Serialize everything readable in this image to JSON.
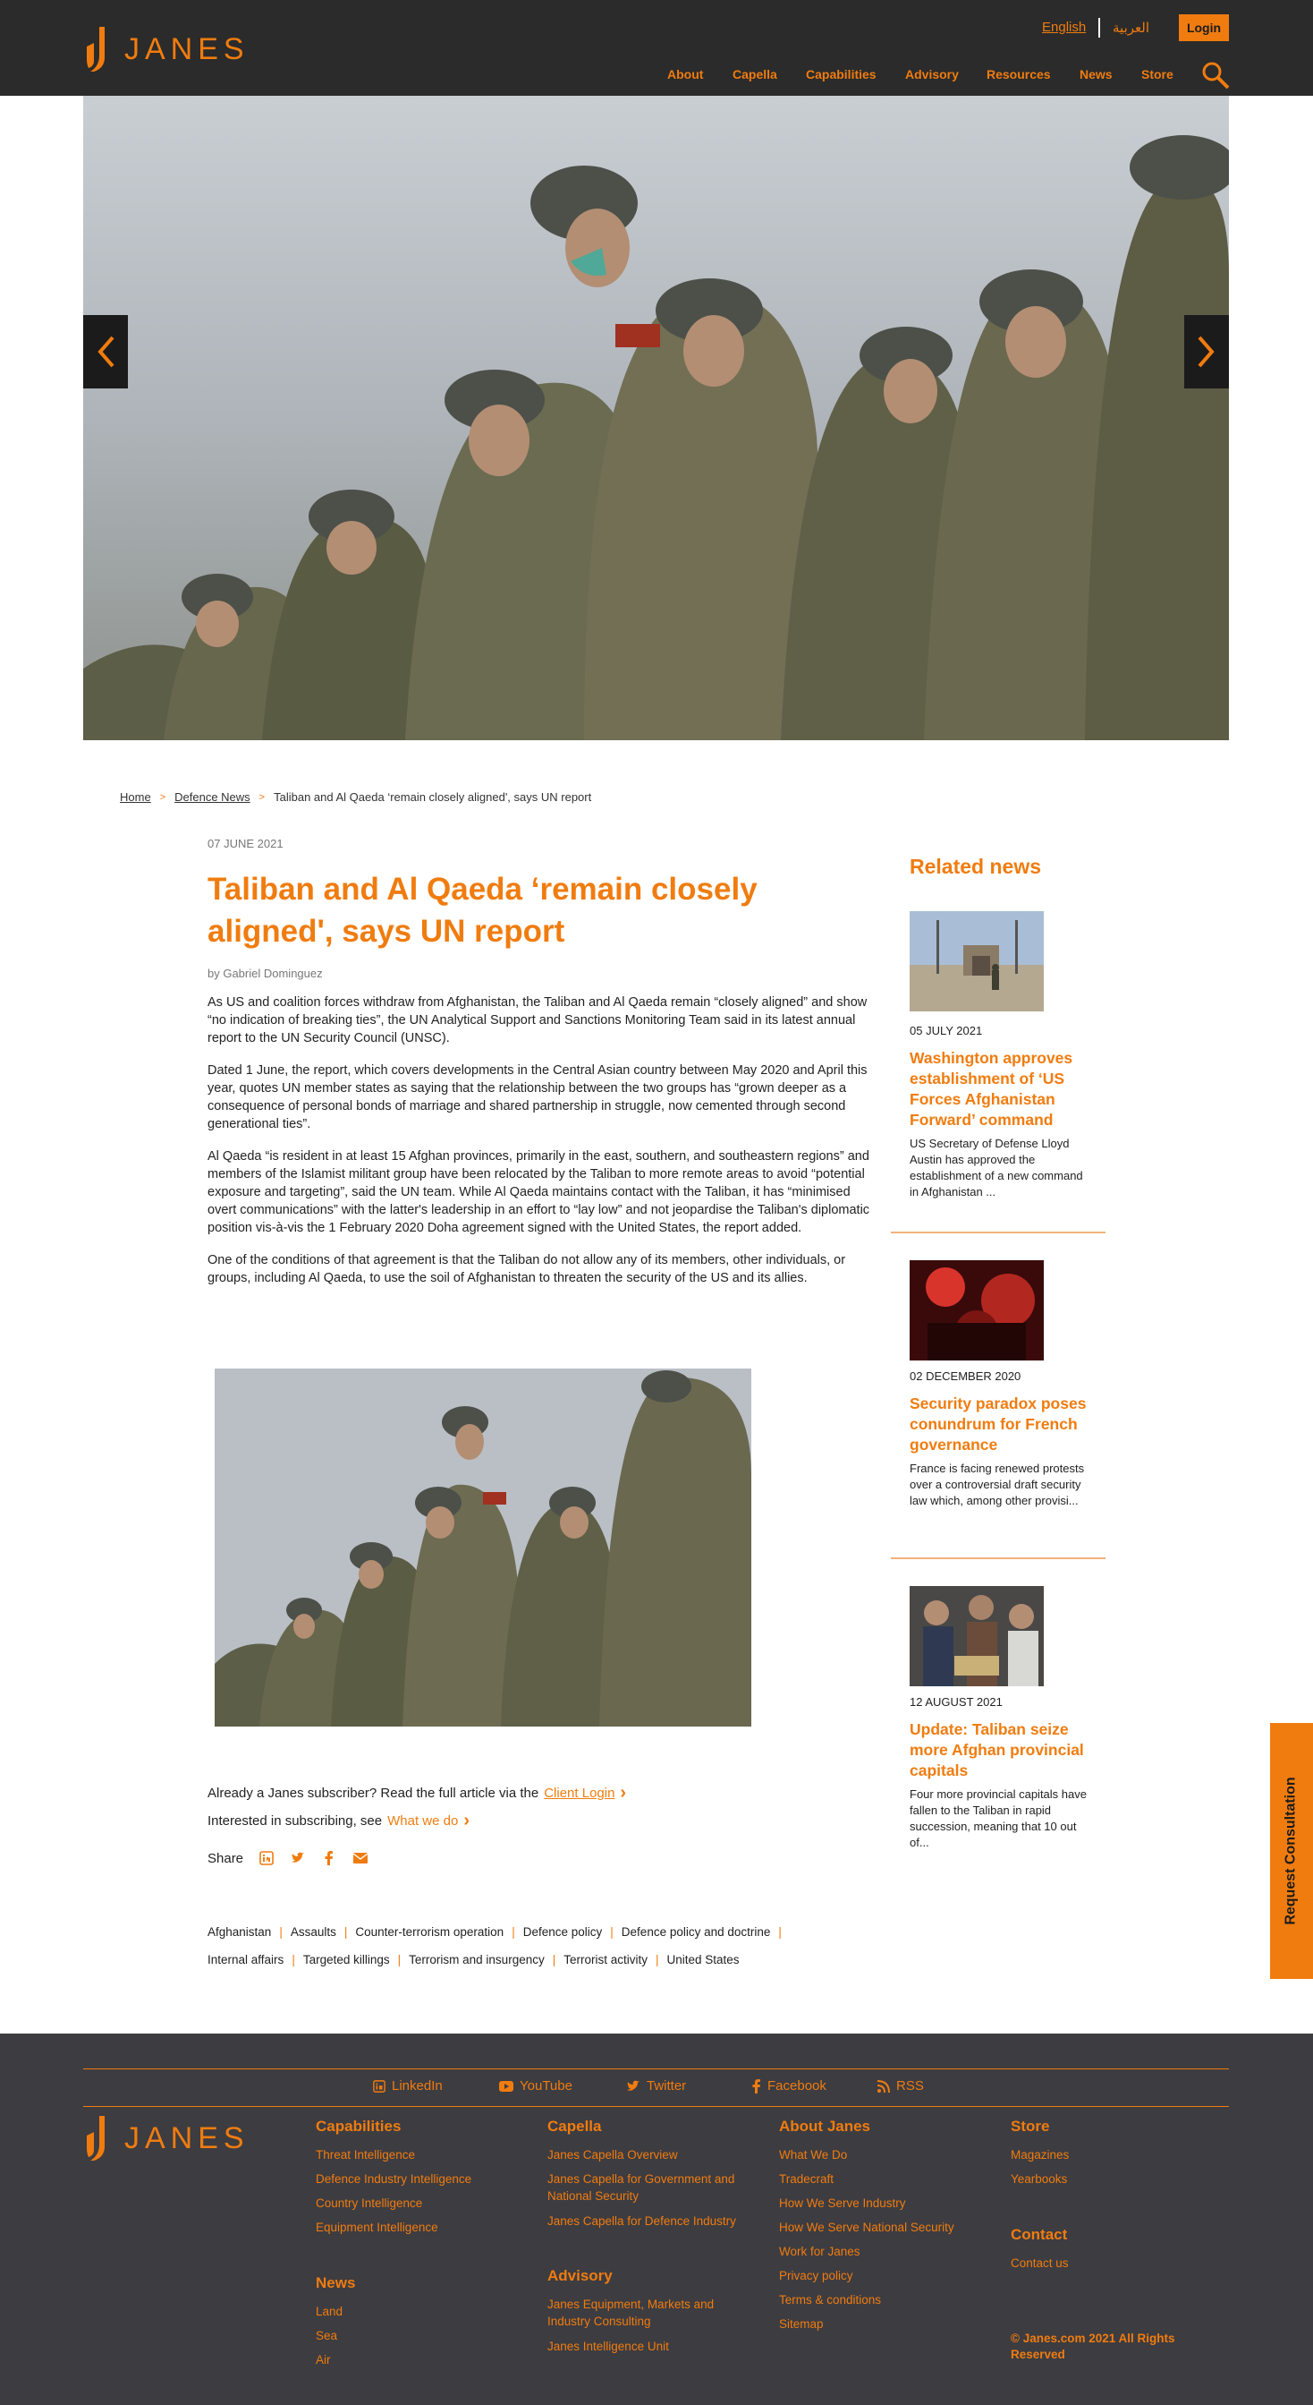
{
  "header": {
    "logo_text": "JANES",
    "lang_en": "English",
    "lang_ar": "العربية",
    "login": "Login",
    "nav": [
      "About",
      "Capella",
      "Capabilities",
      "Advisory",
      "Resources",
      "News",
      "Store"
    ]
  },
  "breadcrumb": {
    "home": "Home",
    "section": "Defence News",
    "current": "Taliban and Al Qaeda ‘remain closely aligned', says UN report",
    "sep": ">"
  },
  "article": {
    "date": "07 JUNE 2021",
    "title": "Taliban and Al Qaeda ‘remain closely aligned', says UN report",
    "byline": "by Gabriel Dominguez",
    "paragraphs": [
      "As US and coalition forces withdraw from Afghanistan, the Taliban and Al Qaeda remain “closely aligned” and show “no indication of breaking ties”, the UN Analytical Support and Sanctions Monitoring Team said in its latest annual report to the UN Security Council (UNSC).",
      "Dated 1 June, the report, which covers developments in the Central Asian country between May 2020 and April this year, quotes UN member states as saying that the relationship between the two groups has “grown deeper as a consequence of personal bonds of marriage and shared partnership in struggle, now cemented through second generational ties”.",
      "Al Qaeda “is resident in at least 15 Afghan provinces, primarily in the east, southern, and southeastern regions” and members of the Islamist militant group have been relocated by the Taliban to more remote areas to avoid “potential exposure and targeting”, said the UN team. While Al Qaeda maintains contact with the Taliban, it has “minimised overt communications” with the latter's leadership in an effort to “lay low” and not jeopardise the Taliban's diplomatic position vis-à-vis the 1 February 2020 Doha agreement signed with the United States, the report added.",
      "One of the conditions of that agreement is that the Taliban do not allow any of its members, other individuals, or groups, including Al Qaeda, to use the soil of Afghanistan to threaten the security of the US and its allies."
    ],
    "subscriber_text": "Already a Janes subscriber? Read the full article via the",
    "client_login": "Client Login",
    "interested_text": "Interested in subscribing, see",
    "what_we_do": "What we do",
    "share_label": "Share",
    "share_icons": [
      "linkedin-icon",
      "twitter-icon",
      "facebook-icon",
      "email-icon"
    ],
    "tags_row1": [
      "Afghanistan",
      "Assaults",
      "Counter-terrorism operation",
      "Defence policy",
      "Defence policy and doctrine"
    ],
    "tags_row2": [
      "Internal affairs",
      "Targeted killings",
      "Terrorism and insurgency",
      "Terrorist activity",
      "United States"
    ]
  },
  "related": {
    "heading": "Related news",
    "items": [
      {
        "date": "05 JULY 2021",
        "title": "Washington approves establishment of ‘US Forces Afghanistan Forward’ command",
        "body": "US Secretary of Defense Lloyd Austin has approved the establishment of a new command in Afghanistan ..."
      },
      {
        "date": "02 DECEMBER 2020",
        "title": "Security paradox poses conundrum for French governance",
        "body": "France is facing renewed protests over a controversial draft security law which, among other provisi..."
      },
      {
        "date": "12 AUGUST 2021",
        "title": "Update: Taliban seize more Afghan provincial capitals",
        "body": "Four more provincial capitals have fallen to the Taliban in rapid succession, meaning that 10 out of..."
      }
    ]
  },
  "consult_button": "Request Consultation",
  "footer": {
    "social": [
      "LinkedIn",
      "YouTube",
      "Twitter",
      "Facebook",
      "RSS"
    ],
    "logo_text": "JANES",
    "columns": {
      "capabilities": {
        "heading": "Capabilities",
        "links": [
          "Threat Intelligence",
          "Defence Industry Intelligence",
          "Country Intelligence",
          "Equipment Intelligence"
        ]
      },
      "news": {
        "heading": "News",
        "links": [
          "Land",
          "Sea",
          "Air"
        ]
      },
      "capella": {
        "heading": "Capella",
        "links": [
          "Janes Capella Overview",
          "Janes Capella for Government and National Security",
          "Janes Capella for Defence Industry"
        ]
      },
      "advisory": {
        "heading": "Advisory",
        "links": [
          "Janes Equipment, Markets and Industry Consulting",
          "Janes Intelligence Unit"
        ]
      },
      "about": {
        "heading": "About Janes",
        "links": [
          "What We Do",
          "Tradecraft",
          "How We Serve Industry",
          "How We Serve National Security",
          "Work for Janes",
          "Privacy policy",
          "Terms & conditions",
          "Sitemap"
        ]
      },
      "store": {
        "heading": "Store",
        "links": [
          "Magazines",
          "Yearbooks"
        ]
      },
      "contact": {
        "heading": "Contact",
        "links": [
          "Contact us"
        ]
      }
    },
    "copyright": "© Janes.com 2021 All Rights Reserved"
  }
}
